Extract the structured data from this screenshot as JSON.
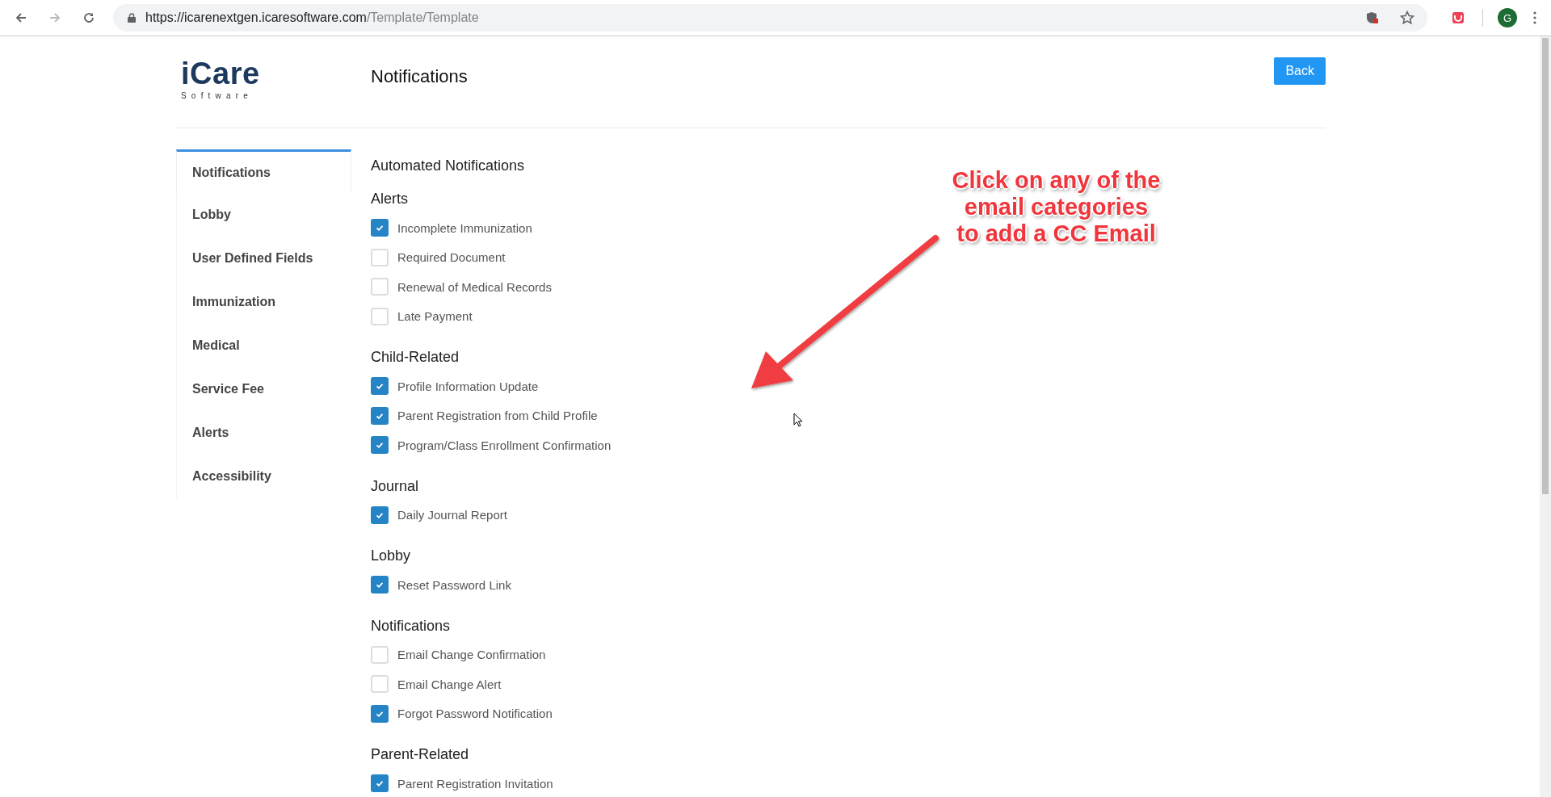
{
  "browser": {
    "url_host": "https://icarenextgen.icaresoftware.com",
    "url_path": "/Template/Template",
    "profile_initial": "G"
  },
  "logo": {
    "name": "iCare",
    "tagline": "Software"
  },
  "page_title": "Notifications",
  "back_button": "Back",
  "sidebar": {
    "items": [
      {
        "label": "Notifications",
        "selected": true
      },
      {
        "label": "Lobby",
        "selected": false
      },
      {
        "label": "User Defined Fields",
        "selected": false
      },
      {
        "label": "Immunization",
        "selected": false
      },
      {
        "label": "Medical",
        "selected": false
      },
      {
        "label": "Service Fee",
        "selected": false
      },
      {
        "label": "Alerts",
        "selected": false
      },
      {
        "label": "Accessibility",
        "selected": false
      }
    ]
  },
  "content": {
    "heading": "Automated Notifications",
    "sections": [
      {
        "title": "Alerts",
        "items": [
          {
            "label": "Incomplete Immunization",
            "checked": true
          },
          {
            "label": "Required Document",
            "checked": false
          },
          {
            "label": "Renewal of Medical Records",
            "checked": false
          },
          {
            "label": "Late Payment",
            "checked": false
          }
        ]
      },
      {
        "title": "Child-Related",
        "items": [
          {
            "label": "Profile Information Update",
            "checked": true
          },
          {
            "label": "Parent Registration from Child Profile",
            "checked": true
          },
          {
            "label": "Program/Class Enrollment Confirmation",
            "checked": true
          }
        ]
      },
      {
        "title": "Journal",
        "items": [
          {
            "label": "Daily Journal Report",
            "checked": true
          }
        ]
      },
      {
        "title": "Lobby",
        "items": [
          {
            "label": "Reset Password Link",
            "checked": true
          }
        ]
      },
      {
        "title": "Notifications",
        "items": [
          {
            "label": "Email Change Confirmation",
            "checked": false
          },
          {
            "label": "Email Change Alert",
            "checked": false
          },
          {
            "label": "Forgot Password Notification",
            "checked": true
          }
        ]
      },
      {
        "title": "Parent-Related",
        "items": [
          {
            "label": "Parent Registration Invitation",
            "checked": true
          }
        ]
      }
    ]
  },
  "annotation": {
    "lines": [
      "Click on any of the",
      "email categories",
      "to add a CC Email"
    ]
  }
}
